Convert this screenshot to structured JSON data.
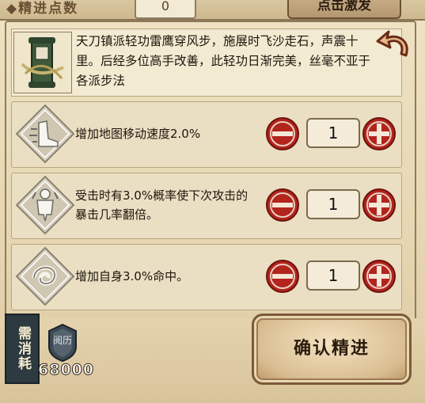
{
  "header": {
    "label": "◆精进点数",
    "value": "0",
    "action_label": "点击激发"
  },
  "skill": {
    "icon": "scroll-icon",
    "description": "天刀镇派轻功雷鹰穿风步，施展时飞沙走石，声震十里。后经多位高手改善，此轻功日渐完美，丝毫不亚于各派步法",
    "back_icon": "return-arrow-icon"
  },
  "upgrades": [
    {
      "icon": "boot-icon",
      "text": "增加地图移动速度2.0%",
      "count": "1"
    },
    {
      "icon": "figure-icon",
      "text": "受击时有3.0%概率使下次攻击的暴击几率翻倍。",
      "count": "1"
    },
    {
      "icon": "swirl-icon",
      "text": "增加自身3.0%命中。",
      "count": "1"
    }
  ],
  "footer": {
    "need_label": "需消耗",
    "currency_icon": "yueli-coin-icon",
    "currency_label": "阅历",
    "cost": "68000",
    "confirm_label": "确认精进"
  },
  "colors": {
    "accent_red": "#b3241c",
    "parchment": "#efe3c4",
    "dark_text": "#1e150c"
  }
}
